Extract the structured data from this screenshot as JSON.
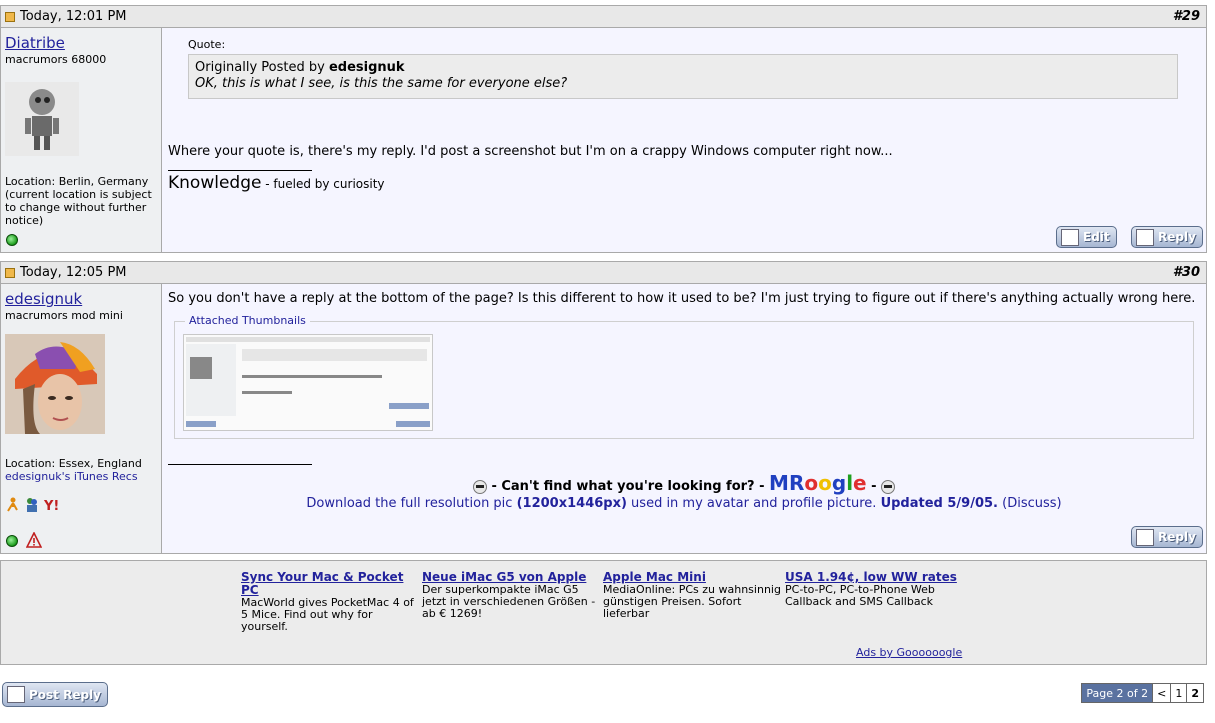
{
  "posts": [
    {
      "date": "Today, 12:01 PM",
      "number": "#29",
      "username": "Diatribe",
      "usertitle": "macrumors 68000",
      "location": "Location: Berlin, Germany (current location is subject to change without further notice)",
      "quote_label": "Quote:",
      "quote_author_prefix": "Originally Posted by",
      "quote_author": "edesignuk",
      "quote_text": "OK, this is what I see, is this the same for everyone else?",
      "message": "Where your quote is, there's my reply. I'd post a screenshot but I'm on a crappy Windows computer right now...",
      "sig_big": "Knowledge",
      "sig_small": " - fueled by curiosity",
      "buttons": {
        "edit": "Edit",
        "reply": "Reply"
      }
    },
    {
      "date": "Today, 12:05 PM",
      "number": "#30",
      "username": "edesignuk",
      "usertitle": "macrumors mod mini",
      "location": "Location: Essex, England",
      "itunes": "edesignuk's iTunes Recs",
      "message": "So you don't have a reply at the bottom of the page? Is this different to how it used to be? I'm just trying to figure out if there's anything actually wrong here.",
      "attachments_label": "Attached Thumbnails",
      "mroogle_prefix": " - Can't find what you're looking for? - ",
      "mroogle_brand": "MRoogle",
      "mroogle_suffix": " - ",
      "download_text": "Download the full resolution pic",
      "download_bold": "(1200x1446px)",
      "download_mid": " used in my avatar and profile picture.",
      "download_updated": "Updated 5/9/05.",
      "discuss": "(Discuss)",
      "buttons": {
        "reply": "Reply"
      }
    }
  ],
  "ads": [
    {
      "title": "Sync Your Mac & Pocket PC",
      "text": "MacWorld gives PocketMac 4 of 5 Mice. Find out why for yourself."
    },
    {
      "title": "Neue iMac G5 von Apple",
      "text": "Der superkompakte iMac G5 jetzt in verschiedenen Größen - ab € 1269!"
    },
    {
      "title": "Apple Mac Mini",
      "text": "MediaOnline: PCs zu wahnsinnig günstigen Preisen. Sofort lieferbar"
    },
    {
      "title": "USA 1.94¢, low WW rates",
      "text": "PC-to-PC, PC-to-Phone Web Callback and SMS Callback"
    }
  ],
  "ads_by": "Ads by Goooooogle",
  "post_reply": "Post Reply",
  "pager": {
    "label": "Page 2 of 2",
    "prev": "<",
    "pages": [
      "1",
      "2"
    ]
  },
  "colors": {
    "link": "#22229c",
    "header_bg": "#e8e8e8",
    "post_bg": "#f5f5ff"
  }
}
